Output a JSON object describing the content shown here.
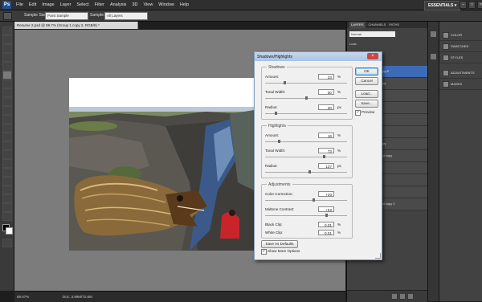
{
  "menubar": {
    "logo": "Ps",
    "items": [
      "File",
      "Edit",
      "Image",
      "Layer",
      "Select",
      "Filter",
      "Analysis",
      "3D",
      "View",
      "Window",
      "Help"
    ],
    "workspace": "ESSENTIALS ▾"
  },
  "optionsbar": {
    "sample_size_label": "Sample Size:",
    "sample_size_value": "Point Sample",
    "sample_label": "Sample:",
    "sample_value": "All Layers"
  },
  "document": {
    "tab": "Resume 2.psd @ 89.7% (Group 1 copy 2, RGB/8) *",
    "zoom": "89.67%",
    "doc_size": "Doc: 3.99M/72.6M"
  },
  "layers": {
    "tabs": [
      "LAYERS",
      "CHANNELS",
      "PATHS"
    ],
    "blend": "Normal",
    "lock": "Lock:",
    "rows": [
      {
        "label": "copy 3",
        "selected": true
      },
      {
        "label": "copy",
        "selected": false
      },
      {
        "label": "",
        "selected": false
      },
      {
        "label": "",
        "selected": false
      },
      {
        "label": "",
        "selected": false
      },
      {
        "label": "",
        "selected": false
      },
      {
        "label": "copy",
        "selected": false
      },
      {
        "label": "und copy",
        "selected": false
      },
      {
        "label": "",
        "selected": false
      },
      {
        "label": "",
        "selected": false
      },
      {
        "label": "",
        "selected": false
      },
      {
        "label": "und copy 2",
        "selected": false
      }
    ]
  },
  "side_panels": [
    {
      "icon": "color-icon",
      "label": "COLOR"
    },
    {
      "icon": "swatches-icon",
      "label": "SWATCHES"
    },
    {
      "icon": "styles-icon",
      "label": "STYLES"
    },
    {
      "icon": "adjustments-icon",
      "label": "ADJUSTMENTS"
    },
    {
      "icon": "masks-icon",
      "label": "MASKS"
    }
  ],
  "dialog": {
    "title": "Shadows/Highlights",
    "shadows": {
      "title": "Shadows",
      "amount": {
        "label": "Amount:",
        "value": "23",
        "unit": "%",
        "level": 0.23
      },
      "tonal_width": {
        "label": "Tonal Width:",
        "value": "50",
        "unit": "%",
        "level": 0.5
      },
      "radius": {
        "label": "Radius:",
        "value": "30",
        "unit": "px",
        "level": 0.12
      }
    },
    "highlights": {
      "title": "Highlights",
      "amount": {
        "label": "Amount:",
        "value": "16",
        "unit": "%",
        "level": 0.16
      },
      "tonal_width": {
        "label": "Tonal Width:",
        "value": "73",
        "unit": "%",
        "level": 0.73
      },
      "radius": {
        "label": "Radius:",
        "value": "137",
        "unit": "px",
        "level": 0.55
      }
    },
    "adjustments": {
      "title": "Adjustments",
      "color_correction": {
        "label": "Color Correction:",
        "value": "+20",
        "level": 0.6
      },
      "midtone_contrast": {
        "label": "Midtone Contrast:",
        "value": "+52",
        "level": 0.76
      },
      "black_clip": {
        "label": "Black Clip:",
        "value": "0.01",
        "unit": "%"
      },
      "white_clip": {
        "label": "White Clip:",
        "value": "0.01",
        "unit": "%"
      }
    },
    "buttons": {
      "ok": "OK",
      "cancel": "Cancel",
      "load": "Load...",
      "save": "Save..."
    },
    "preview": {
      "label": "Preview",
      "checked": true
    },
    "save_defaults": "Save As Defaults",
    "show_more": {
      "label": "Show More Options",
      "checked": true
    }
  }
}
